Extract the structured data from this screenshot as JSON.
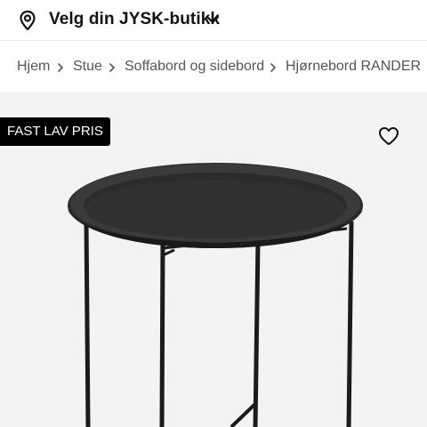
{
  "store_bar": {
    "icon": "location-pin-icon",
    "label": "Velg din JYSK-butikk",
    "dropdown_icon": "chevron-down-icon"
  },
  "breadcrumb": {
    "items": [
      "Hjem",
      "Stue",
      "Soffabord og sidebord",
      "Hjørnebord RANDER"
    ],
    "separator_icon": "chevron-right-icon"
  },
  "product": {
    "badge": "FAST LAV PRIS",
    "favorite_icon": "heart-outline-icon",
    "image": "round-black-metal-tray-side-table"
  },
  "colors": {
    "badge_bg": "#000000",
    "product_bg": "#f3f3f3",
    "text": "#111111",
    "breadcrumb_text": "#555555"
  }
}
